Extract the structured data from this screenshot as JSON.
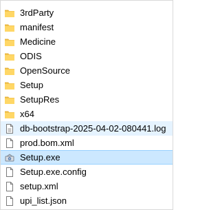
{
  "colors": {
    "folder_body": "#ffd766",
    "folder_tab": "#e8b53c",
    "selection_bg": "#cce8ff",
    "selection_border": "#99d1ff"
  },
  "files": [
    {
      "name": "3rdParty",
      "icon": "folder-icon",
      "kind": "folder"
    },
    {
      "name": "manifest",
      "icon": "folder-icon",
      "kind": "folder"
    },
    {
      "name": "Medicine",
      "icon": "folder-icon",
      "kind": "folder"
    },
    {
      "name": "ODIS",
      "icon": "folder-icon",
      "kind": "folder"
    },
    {
      "name": "OpenSource",
      "icon": "folder-icon",
      "kind": "folder"
    },
    {
      "name": "Setup",
      "icon": "folder-icon",
      "kind": "folder"
    },
    {
      "name": "SetupRes",
      "icon": "folder-icon",
      "kind": "folder"
    },
    {
      "name": "x64",
      "icon": "folder-icon",
      "kind": "folder"
    },
    {
      "name": "db-bootstrap-2025-04-02-080441.log",
      "icon": "text-file-icon",
      "kind": "file",
      "state": "hover"
    },
    {
      "name": "prod.bom.xml",
      "icon": "file-icon",
      "kind": "file"
    },
    {
      "name": "Setup.exe",
      "icon": "installer-exe-icon",
      "kind": "exe",
      "state": "selected"
    },
    {
      "name": "Setup.exe.config",
      "icon": "file-icon",
      "kind": "file"
    },
    {
      "name": "setup.xml",
      "icon": "file-icon",
      "kind": "file"
    },
    {
      "name": "upi_list.json",
      "icon": "file-icon",
      "kind": "file"
    }
  ]
}
